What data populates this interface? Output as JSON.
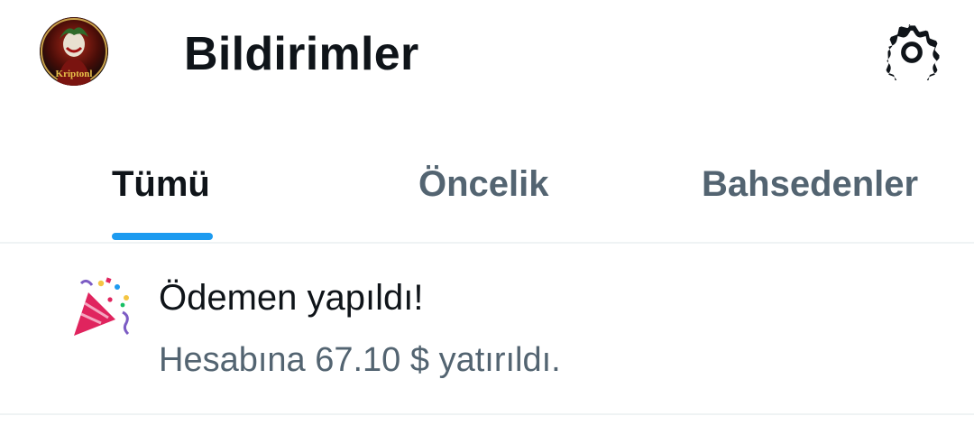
{
  "header": {
    "title": "Bildirimler",
    "avatar_text": "Kriptonl",
    "avatar_icon": "profile-avatar",
    "settings_icon": "gear-icon"
  },
  "tabs": [
    {
      "label": "Tümü",
      "active": true
    },
    {
      "label": "Öncelik",
      "active": false
    },
    {
      "label": "Bahsedenler",
      "active": false
    }
  ],
  "colors": {
    "accent": "#1d9bf0",
    "text_primary": "#0f1419",
    "text_secondary": "#536471",
    "divider": "#eff3f4"
  },
  "notifications": [
    {
      "icon": "party-popper-icon",
      "title": "Ödemen yapıldı!",
      "body": "Hesabına 67.10 $ yatırıldı."
    }
  ]
}
